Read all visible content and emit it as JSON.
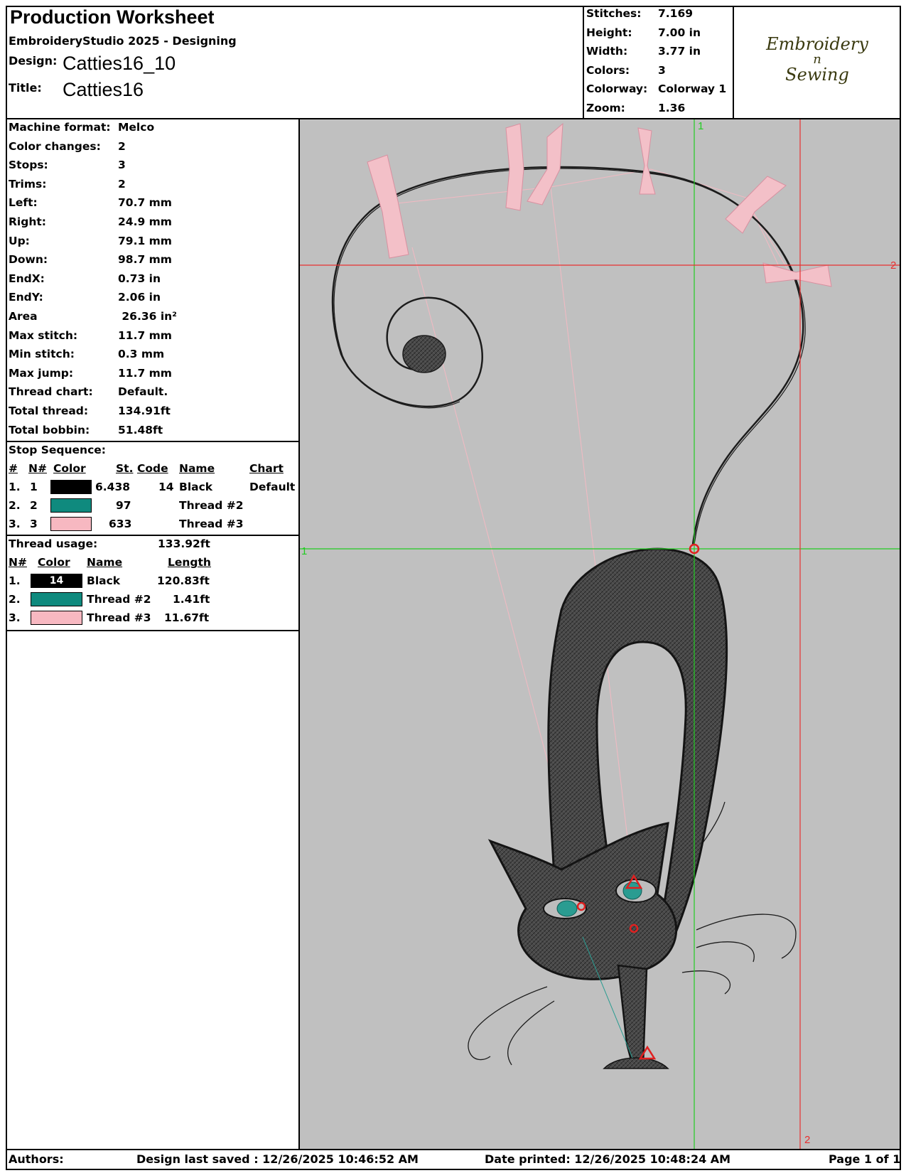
{
  "header": {
    "title": "Production Worksheet",
    "software": "EmbroideryStudio 2025 - Designing",
    "design_label": "Design:",
    "design_value": "Catties16_10",
    "title_label": "Title:",
    "title_value": "Catties16"
  },
  "specs": [
    {
      "label": "Stitches:",
      "value": "7.169"
    },
    {
      "label": "Height:",
      "value": "7.00 in"
    },
    {
      "label": "Width:",
      "value": "3.77 in"
    },
    {
      "label": "Colors:",
      "value": "3"
    },
    {
      "label": "Colorway:",
      "value": "Colorway 1"
    },
    {
      "label": "Zoom:",
      "value": "1.36"
    }
  ],
  "logo": {
    "line1": "Embroidery",
    "line2": "n",
    "line3": "Sewing"
  },
  "machine_info": [
    {
      "label": "Machine format:",
      "value": "Melco"
    },
    {
      "label": "Color changes:",
      "value": "2"
    },
    {
      "label": "Stops:",
      "value": "3"
    },
    {
      "label": "Trims:",
      "value": "2"
    },
    {
      "label": "Left:",
      "value": "70.7 mm"
    },
    {
      "label": "Right:",
      "value": "24.9 mm"
    },
    {
      "label": "Up:",
      "value": "79.1 mm"
    },
    {
      "label": "Down:",
      "value": "98.7 mm"
    },
    {
      "label": "EndX:",
      "value": "0.73 in"
    },
    {
      "label": "EndY:",
      "value": "2.06 in"
    },
    {
      "label": "Area",
      "value": " 26.36 in²"
    },
    {
      "label": "Max stitch:",
      "value": "11.7 mm"
    },
    {
      "label": "Min stitch:",
      "value": "0.3 mm"
    },
    {
      "label": "Max jump:",
      "value": "11.7 mm"
    },
    {
      "label": "Thread chart:",
      "value": "Default."
    },
    {
      "label": "Total thread:",
      "value": "134.91ft"
    },
    {
      "label": "Total bobbin:",
      "value": "51.48ft"
    }
  ],
  "stop_sequence": {
    "title": "Stop Sequence:",
    "headers": {
      "num": "#",
      "n": "N#",
      "color": "Color",
      "st": "St.",
      "code": "Code",
      "name": "Name",
      "chart": "Chart"
    },
    "rows": [
      {
        "num": "1.",
        "n": "1",
        "color": "#000000",
        "st": "6.438",
        "code": "14",
        "name": "Black",
        "chart": "Default"
      },
      {
        "num": "2.",
        "n": "2",
        "color": "#0f8a7e",
        "st": "97",
        "code": "",
        "name": "Thread #2",
        "chart": ""
      },
      {
        "num": "3.",
        "n": "3",
        "color": "#f7b8c1",
        "st": "633",
        "code": "",
        "name": "Thread #3",
        "chart": ""
      }
    ]
  },
  "thread_usage": {
    "title": "Thread usage:",
    "total": "133.92ft",
    "headers": {
      "n": "N#",
      "color": "Color",
      "name": "Name",
      "length": "Length"
    },
    "rows": [
      {
        "n": "1.",
        "color": "#000000",
        "code": "14",
        "name": "Black",
        "length": "120.83ft"
      },
      {
        "n": "2.",
        "color": "#0f8a7e",
        "code": "",
        "name": "Thread #2",
        "length": "1.41ft"
      },
      {
        "n": "3.",
        "color": "#f7b8c1",
        "code": "",
        "name": "Thread #3",
        "length": "11.67ft"
      }
    ]
  },
  "preview": {
    "background": "#c0c0c0",
    "guide_green": "#22cc22",
    "guide_red": "#e83030",
    "v_green_label": "1",
    "h_red_label": "2",
    "h_green_label": "1",
    "v_red_label": "2"
  },
  "footer": {
    "authors": "Authors:",
    "saved": "Design last saved : 12/26/2025 10:46:52 AM",
    "printed": "Date printed: 12/26/2025 10:48:24 AM",
    "page": "Page 1 of 1"
  }
}
